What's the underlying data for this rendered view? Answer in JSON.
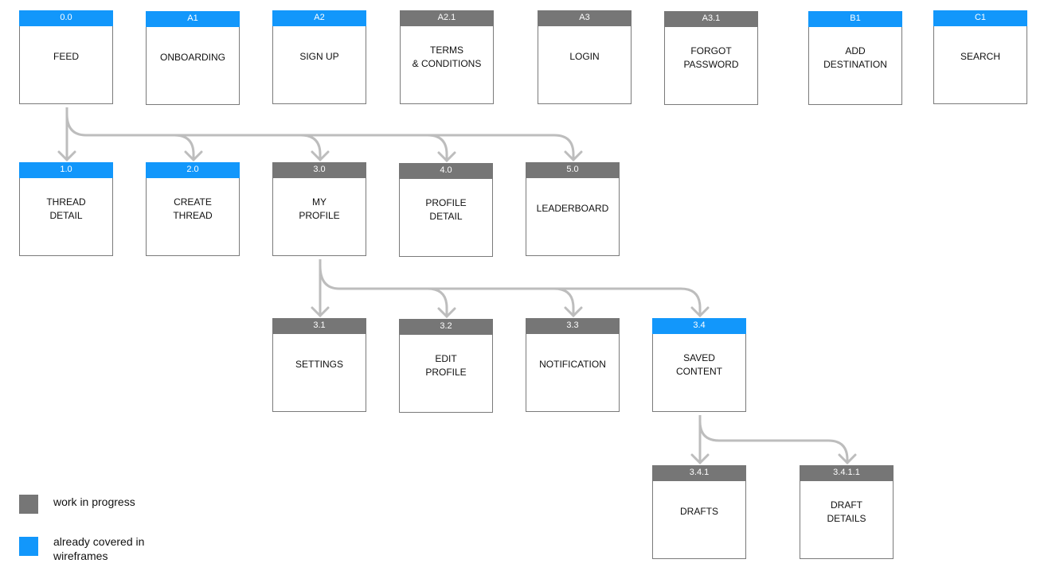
{
  "colors": {
    "work_in_progress": "#767676",
    "already_covered": "#1297fb",
    "connector": "#bdbdbd"
  },
  "nodes": [
    {
      "id": "0.0",
      "label": "FEED",
      "status": "done"
    },
    {
      "id": "A1",
      "label": "ONBOARDING",
      "status": "done"
    },
    {
      "id": "A2",
      "label": "SIGN UP",
      "status": "done"
    },
    {
      "id": "A2.1",
      "label": "TERMS\n& CONDITIONS",
      "status": "wip"
    },
    {
      "id": "A3",
      "label": "LOGIN",
      "status": "wip"
    },
    {
      "id": "A3.1",
      "label": "FORGOT\nPASSWORD",
      "status": "wip"
    },
    {
      "id": "B1",
      "label": "ADD\nDESTINATION",
      "status": "done"
    },
    {
      "id": "C1",
      "label": "SEARCH",
      "status": "done"
    },
    {
      "id": "1.0",
      "label": "THREAD\nDETAIL",
      "status": "done"
    },
    {
      "id": "2.0",
      "label": "CREATE\nTHREAD",
      "status": "done"
    },
    {
      "id": "3.0",
      "label": "MY\nPROFILE",
      "status": "wip"
    },
    {
      "id": "4.0",
      "label": "PROFILE\nDETAIL",
      "status": "wip"
    },
    {
      "id": "5.0",
      "label": "LEADERBOARD",
      "status": "wip"
    },
    {
      "id": "3.1",
      "label": "SETTINGS",
      "status": "wip"
    },
    {
      "id": "3.2",
      "label": "EDIT\nPROFILE",
      "status": "wip"
    },
    {
      "id": "3.3",
      "label": "NOTIFICATION",
      "status": "wip"
    },
    {
      "id": "3.4",
      "label": "SAVED\nCONTENT",
      "status": "done"
    },
    {
      "id": "3.4.1",
      "label": "DRAFTS",
      "status": "wip"
    },
    {
      "id": "3.4.1.1",
      "label": "DRAFT\nDETAILS",
      "status": "wip"
    }
  ],
  "edges": [
    {
      "from": "0.0",
      "to": [
        "1.0",
        "2.0",
        "3.0",
        "4.0",
        "5.0"
      ]
    },
    {
      "from": "3.0",
      "to": [
        "3.1",
        "3.2",
        "3.3",
        "3.4"
      ]
    },
    {
      "from": "3.4",
      "to": [
        "3.4.1",
        "3.4.1.1"
      ]
    }
  ],
  "legend": [
    {
      "key": "wip",
      "text": "work in progress"
    },
    {
      "key": "done",
      "text": "already covered in wireframes"
    }
  ]
}
